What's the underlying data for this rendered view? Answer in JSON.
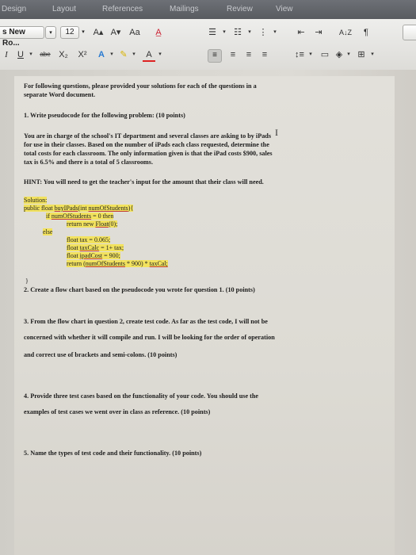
{
  "tabs": [
    "Design",
    "Layout",
    "References",
    "Mailings",
    "Review",
    "View"
  ],
  "toolbar": {
    "font_name": "s New Ro...",
    "font_size": "12",
    "grow_font": "A▴",
    "shrink_font": "A▾",
    "clear_format": "A̲",
    "italic": "I",
    "underline": "U",
    "strike": "abe",
    "subscript": "X₂",
    "superscript": "X²",
    "sort": "A↓Z",
    "pilcrow": "¶"
  },
  "doc": {
    "intro": [
      "For following questions, please provided your solutions for each of the questions in a",
      "separate Word document."
    ],
    "q1": "1.   Write pseudocode for the following problem: (10 points)",
    "q1_body": [
      "You are in charge of the school's IT department and several classes are asking to by iPads",
      "for use in their classes. Based on the number of iPads each class requested, determine the",
      "total costs for each classroom. The only information given is that the iPad costs $900, sales",
      "tax is 6.5% and there is a total of 5 classrooms."
    ],
    "hint": "HINT: You will need to get the teacher's input for the amount that their class will need.",
    "solution": {
      "label": "Solution:",
      "l1a": "public float ",
      "l1b": "buyIPads",
      "l1c": "(int ",
      "l1d": "numOfStudents",
      "l1e": "){",
      "l2a": "if ",
      "l2b": "numOfStudents",
      "l2c": " = 0 then",
      "l3a": "return new ",
      "l3b": "Float",
      "l3c": "(0);",
      "l4": "else",
      "l5": "float tax = 0.065;",
      "l6a": "float ",
      "l6b": "taxCalc",
      "l6c": " = 1+ tax;",
      "l7a": "float ",
      "l7b": "ipadCost",
      "l7c": " = 900;",
      "l8a": "return (",
      "l8b": "numOfStudents",
      "l8c": " * 900) * ",
      "l8d": "taxCal;",
      "l9": "}"
    },
    "q2": "2. Create a flow chart based on the pseudocode you wrote for question 1. (10 points)",
    "q3": [
      "3. From the flow chart in question 2, create test code. As far as the test code, I will not be",
      "concerned with whether it will compile and run. I will be looking for the order of operation",
      "and correct use of brackets and semi-colons. (10 points)"
    ],
    "q4": [
      "4. Provide three test cases based on the functionality of your code. You should use the",
      "examples of test cases we went over in class as reference. (10 points)"
    ],
    "q5": "5. Name the types of test code and their functionality. (10 points)"
  }
}
